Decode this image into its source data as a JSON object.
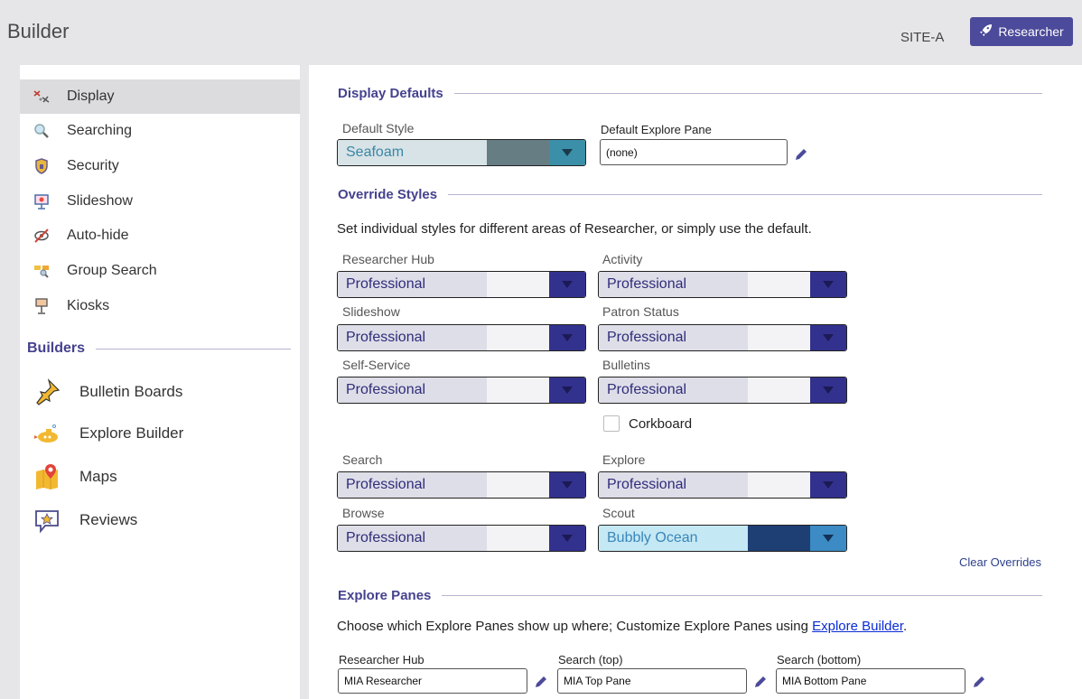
{
  "header": {
    "title": "Builder",
    "site": "SITE-A",
    "researcher_button": "Researcher"
  },
  "sidebar": {
    "items": [
      {
        "label": "Display",
        "icon": "display-icon",
        "active": true
      },
      {
        "label": "Searching",
        "icon": "magnifier-icon"
      },
      {
        "label": "Security",
        "icon": "shield-icon"
      },
      {
        "label": "Slideshow",
        "icon": "presentation-icon"
      },
      {
        "label": "Auto-hide",
        "icon": "eye-slash-icon"
      },
      {
        "label": "Group Search",
        "icon": "group-search-icon"
      },
      {
        "label": "Kiosks",
        "icon": "kiosk-icon"
      }
    ],
    "builders_heading": "Builders",
    "builders": [
      {
        "label": "Bulletin Boards",
        "icon": "pushpin-icon"
      },
      {
        "label": "Explore Builder",
        "icon": "submarine-icon"
      },
      {
        "label": "Maps",
        "icon": "map-pin-icon"
      },
      {
        "label": "Reviews",
        "icon": "star-review-icon"
      }
    ]
  },
  "display_defaults": {
    "heading": "Display Defaults",
    "default_style_label": "Default Style",
    "default_style_value": "Seafoam",
    "default_explore_label": "Default Explore Pane",
    "default_explore_value": "(none)"
  },
  "override_styles": {
    "heading": "Override Styles",
    "description": "Set individual styles for different areas of Researcher, or simply use the default.",
    "fields": {
      "researcher_hub": {
        "label": "Researcher Hub",
        "value": "Professional"
      },
      "activity": {
        "label": "Activity",
        "value": "Professional"
      },
      "slideshow": {
        "label": "Slideshow",
        "value": "Professional"
      },
      "patron_status": {
        "label": "Patron Status",
        "value": "Professional"
      },
      "self_service": {
        "label": "Self-Service",
        "value": "Professional"
      },
      "bulletins": {
        "label": "Bulletins",
        "value": "Professional"
      },
      "search": {
        "label": "Search",
        "value": "Professional"
      },
      "explore": {
        "label": "Explore",
        "value": "Professional"
      },
      "browse": {
        "label": "Browse",
        "value": "Professional"
      },
      "scout": {
        "label": "Scout",
        "value": "Bubbly Ocean"
      }
    },
    "corkboard_label": "Corkboard",
    "corkboard_checked": false,
    "clear_overrides": "Clear Overrides"
  },
  "explore_panes": {
    "heading": "Explore Panes",
    "description_prefix": "Choose which Explore Panes show up where; Customize Explore Panes using ",
    "description_link": "Explore Builder",
    "description_suffix": ".",
    "researcher_hub_label": "Researcher Hub",
    "researcher_hub_value": "MIA Researcher",
    "search_top_label": "Search (top)",
    "search_top_value": "MIA Top Pane",
    "search_bottom_label": "Search (bottom)",
    "search_bottom_value": "MIA Bottom Pane"
  },
  "colors": {
    "accent": "#4c4a9a",
    "heading": "#45428e",
    "professional_arrow": "#33318e",
    "seafoam_arrow": "#3b8fa8",
    "bubbly_ocean_swatch": "#1e3f74"
  }
}
